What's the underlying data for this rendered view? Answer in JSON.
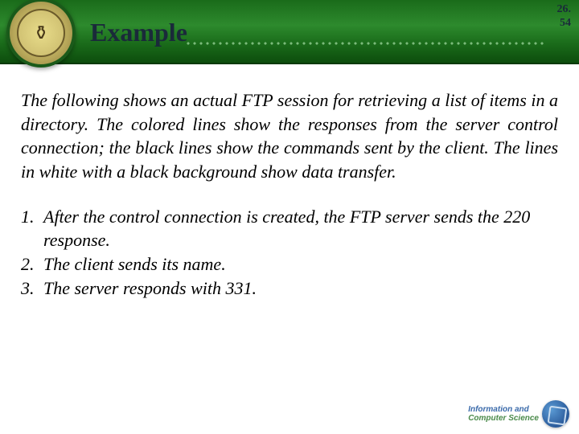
{
  "header": {
    "title": "Example",
    "page_top": "26.",
    "page_bottom": "54"
  },
  "intro": "The following shows an actual FTP session for retrieving a list of items in a directory. The colored lines show the responses from the server control connection; the black lines show the commands sent by the client. The lines in white with a black background show data transfer.",
  "steps": [
    {
      "num": "1.",
      "text": "After the control connection is created, the FTP server sends the 220 response."
    },
    {
      "num": "2.",
      "text": "The client sends its name."
    },
    {
      "num": "3.",
      "text": "The server responds with 331."
    }
  ],
  "footer": {
    "line1": "Information and",
    "line2": "Computer Science"
  }
}
